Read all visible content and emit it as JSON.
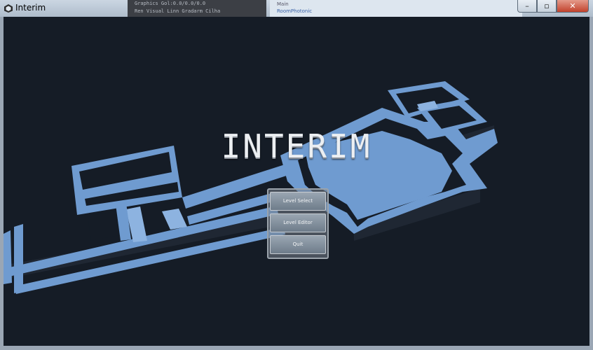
{
  "window": {
    "title": "Interim",
    "controls": {
      "minimize": "–",
      "maximize": "▫",
      "close": "✕"
    }
  },
  "background_panels": {
    "left_line1": "Graphics         Gol:0.0/0.0/0.0",
    "left_line2": "Ren Visual Linn Gradarm Cilha",
    "right_line1": "Main",
    "right_line2": "RoomPhotonic"
  },
  "game": {
    "title": "INTERIM",
    "menu": {
      "level_select": "Level Select",
      "level_editor": "Level Editor",
      "quit": "Quit"
    }
  },
  "colors": {
    "map_fill": "#6f9bd0",
    "map_shadow": "#1f2733",
    "background": "#151c26"
  }
}
